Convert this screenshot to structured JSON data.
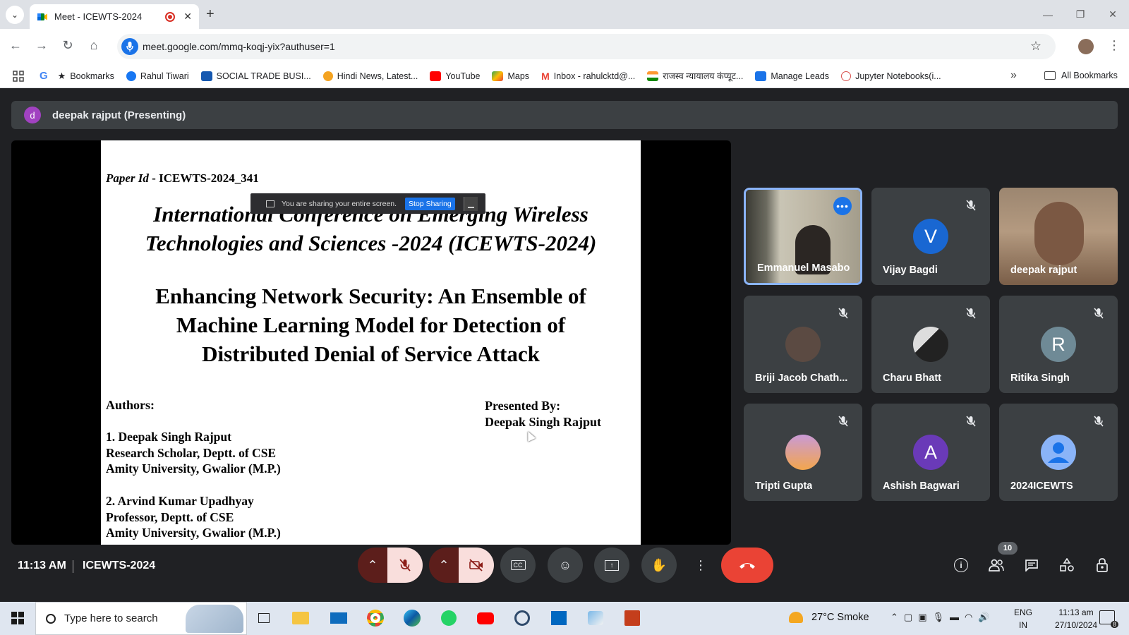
{
  "browser": {
    "tab_title": "Meet - ICEWTS-2024",
    "url": "meet.google.com/mmq-koqj-yix?authuser=1",
    "bookmarks": [
      {
        "label": "Bookmarks",
        "icon": "star-icon"
      },
      {
        "label": "Rahul Tiwari",
        "icon": "facebook-icon"
      },
      {
        "label": "SOCIAL TRADE BUSI...",
        "icon": "st-icon"
      },
      {
        "label": "Hindi News, Latest...",
        "icon": "news-icon"
      },
      {
        "label": "YouTube",
        "icon": "youtube-icon"
      },
      {
        "label": "Maps",
        "icon": "maps-icon"
      },
      {
        "label": "Inbox - rahulcktd@...",
        "icon": "gmail-icon"
      },
      {
        "label": "राजस्व न्यायालय कंप्यूट...",
        "icon": "india-flag-icon"
      },
      {
        "label": "Manage Leads",
        "icon": "leads-icon"
      },
      {
        "label": "Jupyter Notebooks(i...",
        "icon": "jupyter-icon"
      }
    ],
    "all_bookmarks": "All Bookmarks"
  },
  "meet": {
    "presenter_initial": "d",
    "presenter_label": "deepak rajput (Presenting)",
    "slide": {
      "paper_id_prefix": "Paper Id",
      "paper_id_value": " - ICEWTS-2024_341",
      "conference_line1": "International Conference on Emerging Wireless",
      "conference_line2": "Technologies and Sciences -2024 (ICEWTS-2024)",
      "title_line1": "Enhancing Network Security: An Ensemble of",
      "title_line2": "Machine Learning Model for Detection of",
      "title_line3": "Distributed Denial of Service Attack",
      "authors_heading": "Authors:",
      "author1_line1": "1.   Deepak Singh Rajput",
      "author1_line2": "Research Scholar, Deptt. of CSE",
      "author1_line3": "Amity University, Gwalior (M.P.)",
      "author2_line1": "2.  Arvind Kumar Upadhyay",
      "author2_line2": "Professor,  Deptt. of CSE",
      "author2_line3": "Amity University, Gwalior (M.P.)",
      "presented_by": "Presented By:",
      "presenter_full": "Deepak Singh Rajput"
    },
    "share_banner": {
      "text": "You are sharing your entire screen.",
      "stop_label": "Stop Sharing"
    },
    "participants": [
      {
        "name": "Emmanuel Masabo",
        "type": "video",
        "active": true
      },
      {
        "name": "Vijay Bagdi",
        "type": "avatar",
        "initial": "V",
        "color": "#1967d2",
        "muted": true
      },
      {
        "name": "deepak rajput",
        "type": "video"
      },
      {
        "name": "Briji Jacob Chath...",
        "type": "photo",
        "muted": true
      },
      {
        "name": "Charu Bhatt",
        "type": "photo",
        "muted": true
      },
      {
        "name": "Ritika Singh",
        "type": "avatar",
        "initial": "R",
        "color": "#6f8a96",
        "muted": true
      },
      {
        "name": "Tripti Gupta",
        "type": "photo",
        "muted": true
      },
      {
        "name": "Ashish Bagwari",
        "type": "avatar",
        "initial": "A",
        "color": "#6a3ab8",
        "muted": true
      },
      {
        "name": "2024ICEWTS",
        "type": "default",
        "muted": true
      }
    ],
    "controls": {
      "time": "11:13 AM",
      "meeting_name": "ICEWTS-2024",
      "people_count": "10"
    }
  },
  "taskbar": {
    "search_placeholder": "Type here to search",
    "weather": "27°C  Smoke",
    "lang_line1": "ENG",
    "lang_line2": "IN",
    "time": "11:13 am",
    "date": "27/10/2024",
    "notification_count": "8"
  }
}
